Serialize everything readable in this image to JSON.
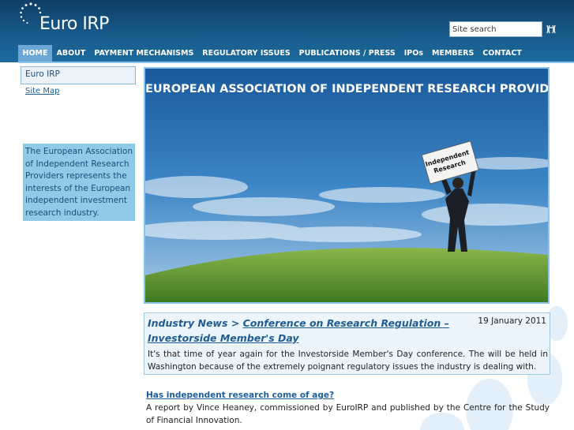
{
  "header": {
    "logo_text": "Euro IRP",
    "search_placeholder": "Site search",
    "search_button": "Ж"
  },
  "nav": {
    "items": [
      "HOME",
      "ABOUT",
      "PAYMENT MECHANISMS",
      "REGULATORY ISSUES",
      "PUBLICATIONS / PRESS",
      "IPOs",
      "MEMBERS",
      "CONTACT"
    ],
    "active": "HOME"
  },
  "sidebar": {
    "box_label": "Euro IRP",
    "sitemap_link": "Site Map",
    "about_text": "The European Association of Independent Research Providers represents the interests of the European independent investment research industry."
  },
  "banner": {
    "title": "EUROPEAN ASSOCIATION OF INDEPENDENT RESEARCH PROVIDERS",
    "sign_line1": "Independent",
    "sign_line2": "Research"
  },
  "news": {
    "prefix": "Industry News >",
    "headline": "Conference on Research Regulation – Investorside Member's Day",
    "date": "19 January 2011",
    "body": "It's that time of year again for the Investorside Member's Day conference. The will be held in Washington because of the extremely poignant regulatory issues the industry is dealing with."
  },
  "article": {
    "title": "Has independent research come of age?",
    "body": "A report by Vince Heaney, commissioned by EuroIRP and published by the Centre for the Study of Financial Innovation."
  },
  "colors": {
    "header_dark": "#0f3f66",
    "nav_active": "#6aa6d6",
    "accent_blue": "#8cc3ea",
    "link_blue": "#1c5e9b"
  }
}
